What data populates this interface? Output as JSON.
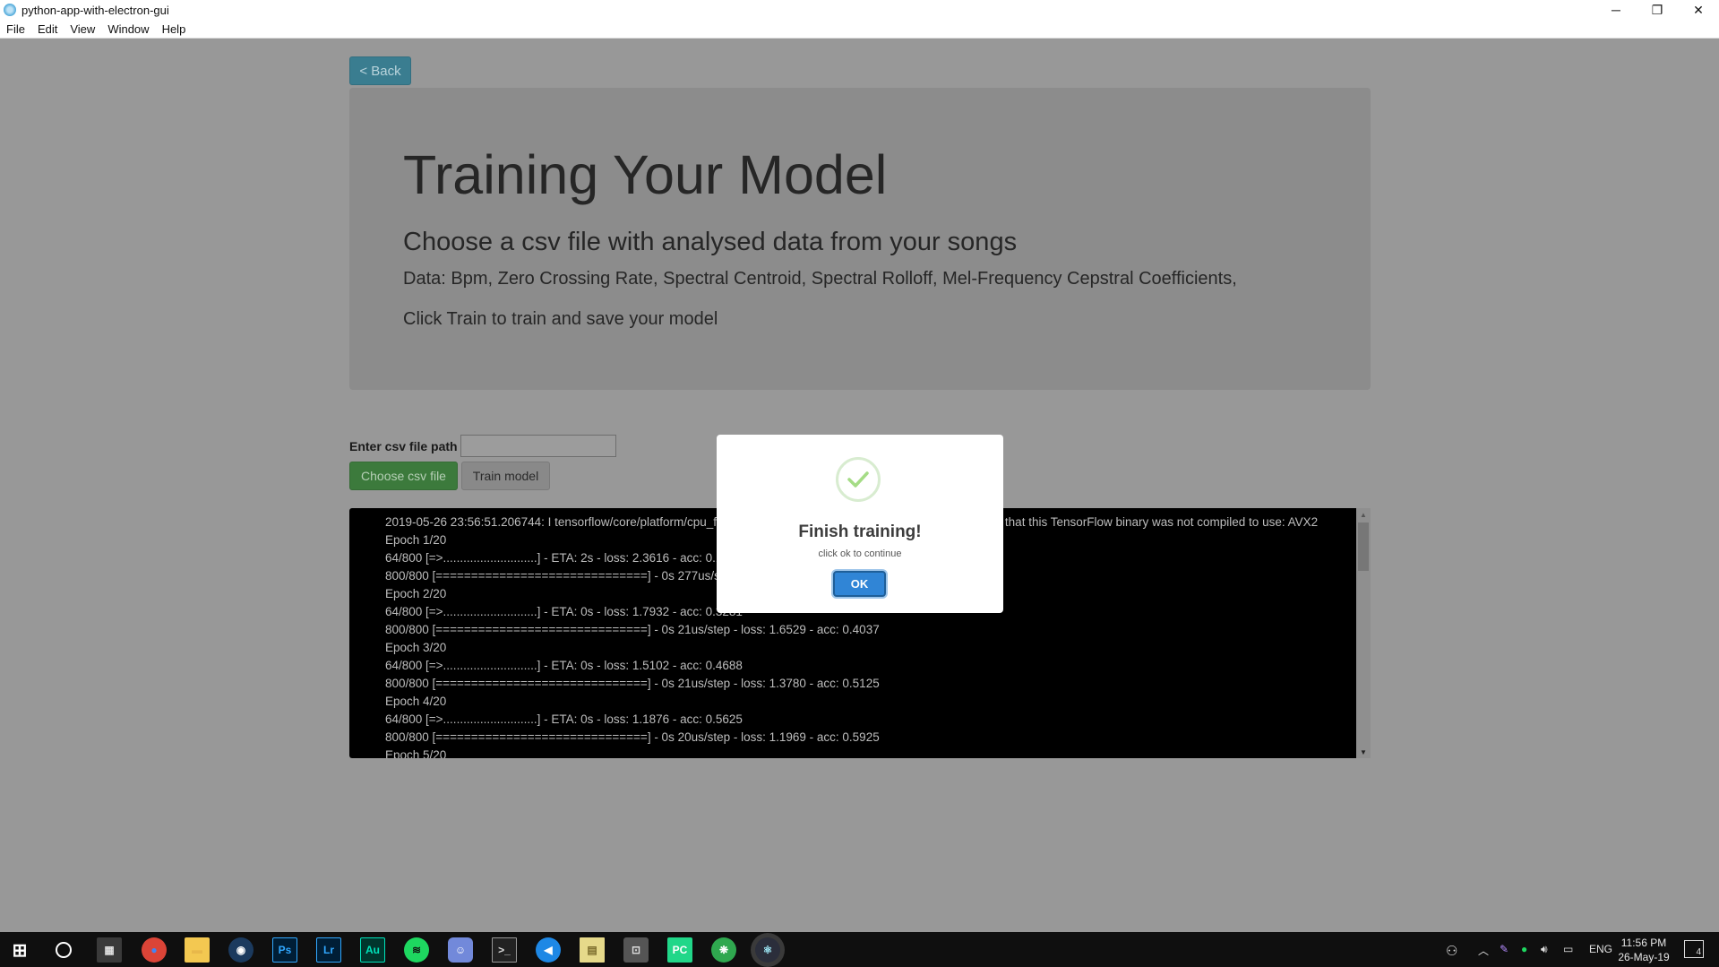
{
  "window": {
    "title": "python-app-with-electron-gui",
    "controls": {
      "minimize": "─",
      "restore": "❐",
      "close": "✕"
    }
  },
  "menu": {
    "items": [
      "File",
      "Edit",
      "View",
      "Window",
      "Help"
    ]
  },
  "page": {
    "back_label": "< Back",
    "heading": "Training Your Model",
    "subheading": "Choose a csv file with analysed data from your songs",
    "data_text": "Data: Bpm, Zero Crossing Rate, Spectral Centroid, Spectral Rolloff, Mel-Frequency Cepstral Coefficients,",
    "instruction_text": "Click Train to train and save your model",
    "csv_label": "Enter csv file path",
    "csv_value": "",
    "choose_label": "Choose csv file",
    "train_label": "Train model"
  },
  "console": {
    "lines": [
      "2019-05-26 23:56:51.206744: I tensorflow/core/platform/cpu_feature_guard.cc:141] Your CPU supports instructions that this TensorFlow binary was not compiled to use: AVX2",
      "Epoch 1/20",
      "64/800 [=>............................] - ETA: 2s - loss: 2.3616 - acc: 0.1406",
      "800/800 [==============================] - 0s 277us/step - loss: 2.1869 - acc: 0.2087",
      "Epoch 2/20",
      "64/800 [=>............................] - ETA: 0s - loss: 1.7932 - acc: 0.3281",
      "800/800 [==============================] - 0s 21us/step - loss: 1.6529 - acc: 0.4037",
      "Epoch 3/20",
      "64/800 [=>............................] - ETA: 0s - loss: 1.5102 - acc: 0.4688",
      "800/800 [==============================] - 0s 21us/step - loss: 1.3780 - acc: 0.5125",
      "Epoch 4/20",
      "64/800 [=>............................] - ETA: 0s - loss: 1.1876 - acc: 0.5625",
      "800/800 [==============================] - 0s 20us/step - loss: 1.1969 - acc: 0.5925",
      "Epoch 5/20"
    ]
  },
  "modal": {
    "icon": "success-check-icon",
    "title": "Finish training!",
    "text": "click ok to continue",
    "ok_label": "OK",
    "accent_color": "#3085d6",
    "check_color": "#a5dc86"
  },
  "taskbar": {
    "apps": [
      {
        "name": "windows-start-icon",
        "glyph": "⊞",
        "color": "#ffffff",
        "bg": "transparent",
        "border": "none",
        "radius": "0"
      },
      {
        "name": "cortana-search-icon",
        "glyph": "",
        "color": "#ffffff",
        "bg": "transparent",
        "border": "2px solid #fff",
        "radius": "50%"
      },
      {
        "name": "calculator-icon",
        "glyph": "▦",
        "color": "#e0e0e0",
        "bg": "#3a3a3a",
        "border": "none",
        "radius": "2px"
      },
      {
        "name": "chrome-icon",
        "glyph": "●",
        "color": "#4285f4",
        "bg": "#db4437",
        "border": "none",
        "radius": "50%"
      },
      {
        "name": "file-explorer-icon",
        "glyph": "▬",
        "color": "#e8b84a",
        "bg": "#f3c851",
        "border": "none",
        "radius": "2px"
      },
      {
        "name": "steam-icon",
        "glyph": "◉",
        "color": "#ffffff",
        "bg": "#1b3a5e",
        "border": "none",
        "radius": "50%"
      },
      {
        "name": "photoshop-icon",
        "glyph": "Ps",
        "color": "#31a8ff",
        "bg": "#001e36",
        "border": "1px solid #31a8ff",
        "radius": "2px"
      },
      {
        "name": "lightroom-icon",
        "glyph": "Lr",
        "color": "#31a8ff",
        "bg": "#001e36",
        "border": "1px solid #31a8ff",
        "radius": "2px"
      },
      {
        "name": "audition-icon",
        "glyph": "Au",
        "color": "#00e4bb",
        "bg": "#00362d",
        "border": "1px solid #00e4bb",
        "radius": "2px"
      },
      {
        "name": "spotify-icon",
        "glyph": "≋",
        "color": "#111111",
        "bg": "#1ed760",
        "border": "none",
        "radius": "50%"
      },
      {
        "name": "discord-icon",
        "glyph": "☺",
        "color": "#ffffff",
        "bg": "#7289da",
        "border": "none",
        "radius": "6px"
      },
      {
        "name": "terminal-icon",
        "glyph": ">_",
        "color": "#dddddd",
        "bg": "#222222",
        "border": "1px solid #999",
        "radius": "1px"
      },
      {
        "name": "audio-app-icon",
        "glyph": "◀",
        "color": "#ffffff",
        "bg": "#1e88e5",
        "border": "none",
        "radius": "50%"
      },
      {
        "name": "notepad-icon",
        "glyph": "▤",
        "color": "#7a6a2a",
        "bg": "#e6d98a",
        "border": "none",
        "radius": "1px"
      },
      {
        "name": "network-app-icon",
        "glyph": "⊡",
        "color": "#dddddd",
        "bg": "#555555",
        "border": "none",
        "radius": "3px"
      },
      {
        "name": "pycharm-icon",
        "glyph": "PC",
        "color": "#ffffff",
        "bg": "#21d789",
        "border": "none",
        "radius": "2px"
      },
      {
        "name": "green-app-icon",
        "glyph": "❋",
        "color": "#ffffff",
        "bg": "#2fa84f",
        "border": "none",
        "radius": "50%"
      },
      {
        "name": "electron-app-icon",
        "glyph": "⚛",
        "color": "#9feaf9",
        "bg": "#2b2e3b",
        "border": "none",
        "radius": "50%"
      }
    ],
    "tray": {
      "people_icon": "people-icon",
      "chevron_icon": "chevron-up-icon",
      "language": "ENG",
      "time": "11:56 PM",
      "date": "26-May-19",
      "notifications_count": "4"
    }
  }
}
